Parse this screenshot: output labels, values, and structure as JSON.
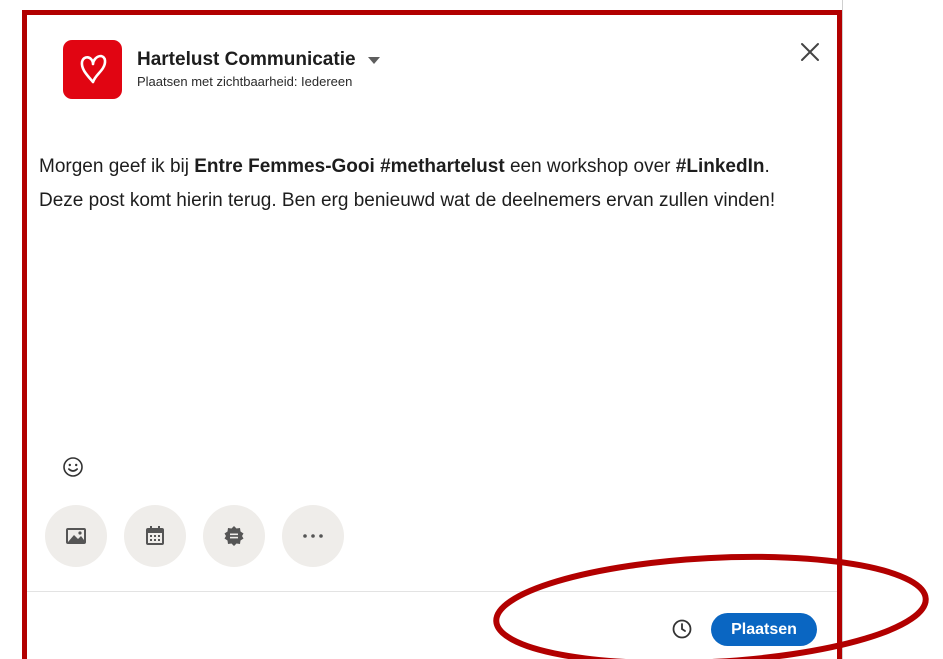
{
  "composer": {
    "author_name": "Hartelust Communicatie",
    "visibility": "Plaatsen met zichtbaarheid: Iedereen",
    "post_segments": [
      {
        "text": "Morgen geef ik bij ",
        "bold": false
      },
      {
        "text": "Entre Femmes-Gooi #methartelust",
        "bold": true
      },
      {
        "text": " een workshop over ",
        "bold": false
      },
      {
        "text": "#LinkedIn",
        "bold": true
      },
      {
        "text": ". Deze post komt hierin terug. Ben erg benieuwd wat de deelnemers ervan zullen vinden!",
        "bold": false
      }
    ],
    "post_button_label": "Plaatsen"
  },
  "icons": {
    "close": "close-icon",
    "logo": "heart-logo-icon",
    "caret": "caret-down-icon",
    "emoji": "smiley-icon",
    "tools": [
      "image-icon",
      "calendar-icon",
      "badge-icon",
      "more-icon"
    ],
    "schedule": "clock-icon"
  },
  "colors": {
    "annotation_red": "#b20000",
    "logo_red": "#e10512",
    "primary_blue": "#0a66c2",
    "tool_bg": "#efedea"
  }
}
